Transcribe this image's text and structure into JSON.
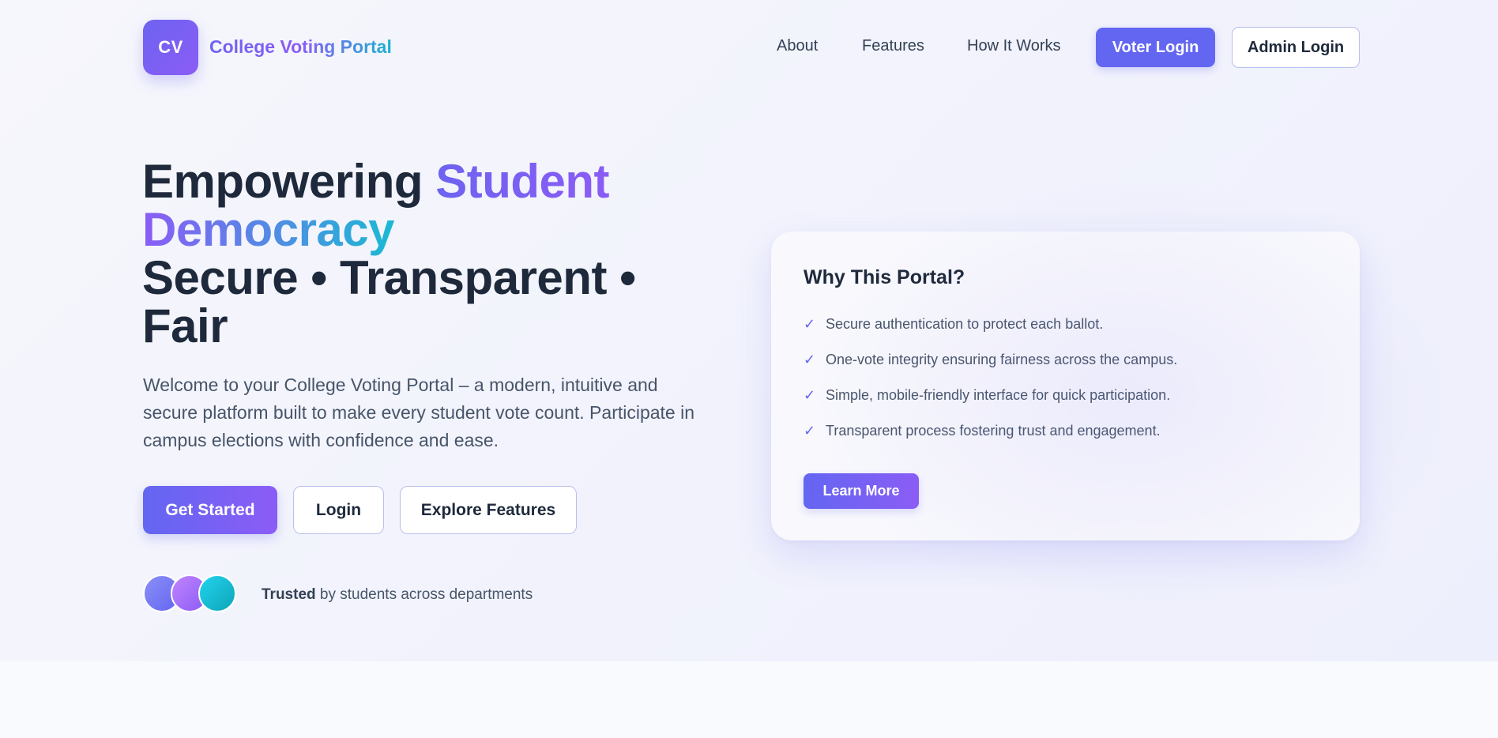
{
  "header": {
    "logo_initials": "CV",
    "brand": "College Voting Portal",
    "nav": [
      "About",
      "Features",
      "How It Works"
    ],
    "voter_login": "Voter Login",
    "admin_login": "Admin Login"
  },
  "hero": {
    "headline_1": "Empowering ",
    "headline_accent_1": "Student",
    "headline_accent_2": "Democracy",
    "headline_2": "Secure • Transparent •",
    "headline_3": "Fair",
    "intro": "Welcome to your College Voting Portal – a modern, intuitive and secure platform built to make every student vote count. Participate in campus elections with confidence and ease.",
    "buttons": {
      "get_started": "Get Started",
      "login": "Login",
      "explore": "Explore Features"
    },
    "trust_bold": "Trusted",
    "trust_rest": " by students across departments"
  },
  "card": {
    "title": "Why This Portal?",
    "check_glyph": "✓",
    "items": [
      "Secure authentication to protect each ballot.",
      "One-vote integrity ensuring fairness across the campus.",
      "Simple, mobile-friendly interface for quick participation.",
      "Transparent process fostering trust and engagement."
    ],
    "learn_more": "Learn More"
  },
  "colors": {
    "accent": "#6366f1",
    "accent_purple": "#8b5cf6",
    "accent_teal": "#1cb9d3",
    "text_dark": "#1e293b",
    "text_muted": "#475569"
  }
}
